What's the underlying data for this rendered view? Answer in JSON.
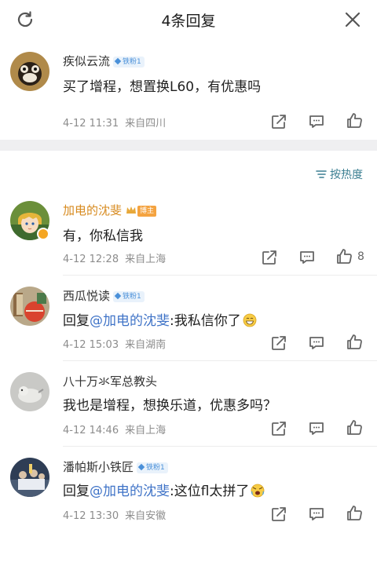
{
  "header": {
    "title": "4条回复",
    "refresh_icon": "refresh-icon",
    "close_icon": "close-icon"
  },
  "root_comment": {
    "username": "疾似云流",
    "badge": "铁粉1",
    "text": "买了增程，想置换L60，有优惠吗",
    "time": "4-12 11:31",
    "location": "来自四川"
  },
  "sort": {
    "label": "按热度",
    "icon": "sort-icon"
  },
  "replies": [
    {
      "username": "加电的沈斐",
      "badge": "博主",
      "text": "有，你私信我",
      "time": "4-12 12:28",
      "location": "来自上海",
      "likes": "8"
    },
    {
      "username": "西瓜悦读",
      "badge": "铁粉1",
      "prefix": "回复",
      "mention": "@加电的沈斐",
      "text": ":我私信你了",
      "emoji": "grin-emoji-icon",
      "time": "4-12 15:03",
      "location": "来自湖南"
    },
    {
      "username": "八十万氺军总教头",
      "text": "我也是增程，想换乐道，优惠多吗？",
      "time": "4-12 14:46",
      "location": "来自上海"
    },
    {
      "username": "潘帕斯小铁匠",
      "badge": "铁粉1",
      "prefix": "回复",
      "mention": "@加电的沈斐",
      "text": ":这位fl太拼了",
      "emoji": "shocked-emoji-icon",
      "time": "4-12 13:30",
      "location": "来自安徽"
    }
  ],
  "colors": {
    "mention": "#3f73c7",
    "gold_name": "#d78a1e",
    "sort_text": "#3b7f92",
    "badge_blue": "#4a90d9",
    "badge_orange": "#f4a340"
  }
}
